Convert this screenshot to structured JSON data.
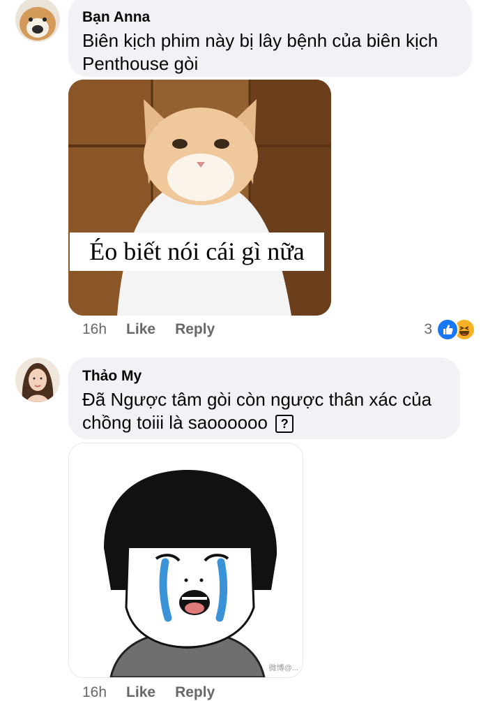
{
  "comments": [
    {
      "author": "Bạn Anna",
      "text_line1": "Biên kịch phim này bị lây bệnh của biên kịch",
      "text_line2": "Penthouse gòi",
      "image_caption": "Éo biết nói cái gì nữa",
      "time": "16h",
      "like_label": "Like",
      "reply_label": "Reply",
      "reaction_count": "3",
      "reaction_icons": [
        "like-icon",
        "haha-icon"
      ]
    },
    {
      "author": "Thảo My",
      "text_line1": "Đã Ngược tâm gòi còn ngược thân xác của",
      "text_line2": "chồng toiii là saoooooo",
      "emoji": "?",
      "image_watermark": "微博@...",
      "time": "16h",
      "like_label": "Like",
      "reply_label": "Reply"
    }
  ],
  "colors": {
    "bubble": "#f0f2f5",
    "meta_text": "#65676b",
    "like_blue": "#1877f2",
    "haha_yellow": "#f7b125"
  }
}
